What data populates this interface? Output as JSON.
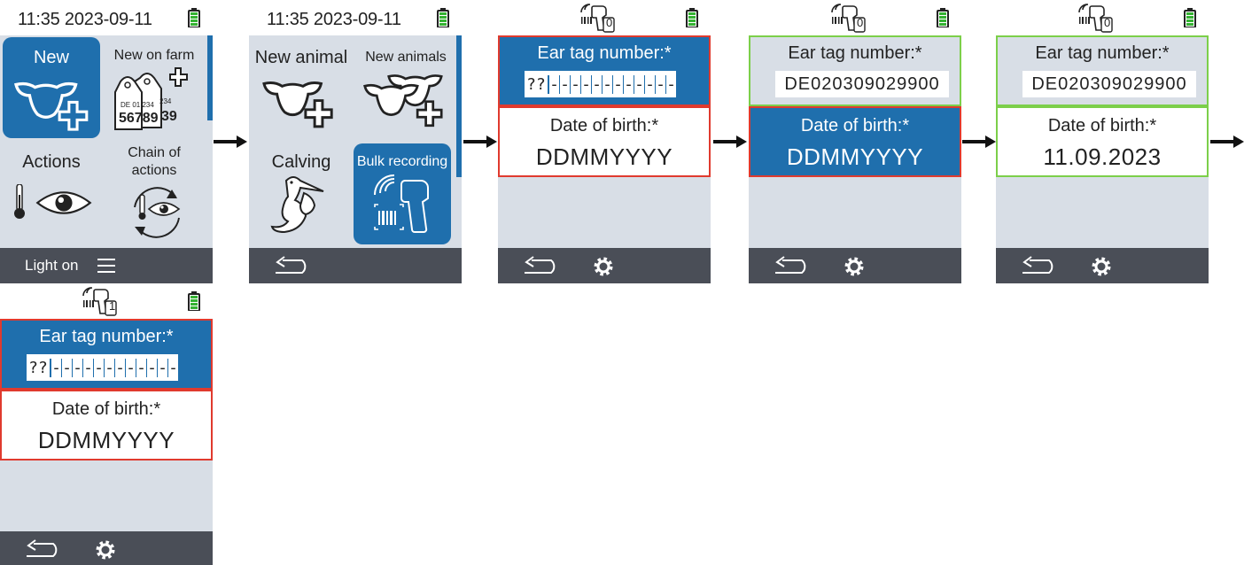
{
  "screens": {
    "s1": {
      "time": "11:35 2023-09-11",
      "tiles": {
        "new": "New",
        "new_on_farm": "New on farm",
        "actions": "Actions",
        "chain_of_actions": "Chain of actions"
      },
      "ear_tag_card": {
        "line1": "DE 01 234",
        "big": "56789",
        "back_top": "234",
        "back_big": "39"
      },
      "bottom": {
        "light": "Light on"
      }
    },
    "s2": {
      "time": "11:35 2023-09-11",
      "tiles": {
        "new_animal": "New animal",
        "new_animals": "New animals",
        "calving": "Calving",
        "bulk_recording": "Bulk recording"
      }
    },
    "s3": {
      "scanner_count": "0",
      "ear_tag_label": "Ear tag number:*",
      "ear_tag_chars": [
        "??",
        "-",
        "-",
        "-",
        "-",
        "-",
        "-",
        "-",
        "-",
        "-",
        "-",
        "-",
        "-"
      ],
      "dob_label": "Date of birth:*",
      "dob_value": "DDMMYYYY"
    },
    "s4": {
      "scanner_count": "0",
      "ear_tag_label": "Ear tag number:*",
      "ear_tag_value": "DE020309029900",
      "dob_label": "Date of birth:*",
      "dob_value": "DDMMYYYY"
    },
    "s5": {
      "scanner_count": "0",
      "ear_tag_label": "Ear tag number:*",
      "ear_tag_value": "DE020309029900",
      "dob_label": "Date of birth:*",
      "dob_value": "11.09.2023"
    },
    "s6": {
      "scanner_count": "1",
      "ear_tag_label": "Ear tag number:*",
      "ear_tag_chars": [
        "??",
        "-",
        "-",
        "-",
        "-",
        "-",
        "-",
        "-",
        "-",
        "-",
        "-",
        "-",
        "-"
      ],
      "dob_label": "Date of birth:*",
      "dob_value": "DDMMYYYY"
    }
  },
  "colors": {
    "accent": "#1f6fad",
    "panel": "#d8dee6",
    "bar": "#4a4e57",
    "error": "#e03a2e",
    "ok": "#7ccf4a",
    "battery": "#35b233"
  },
  "icons": [
    "battery-icon",
    "scanner-icon",
    "back-icon",
    "gear-icon",
    "menu-icon",
    "cow-plus-icon",
    "ear-tag-plus-icon",
    "thermometer-icon",
    "eye-icon",
    "cycle-icon",
    "stork-icon",
    "barcode-scanner-icon",
    "arrow-right-icon"
  ]
}
